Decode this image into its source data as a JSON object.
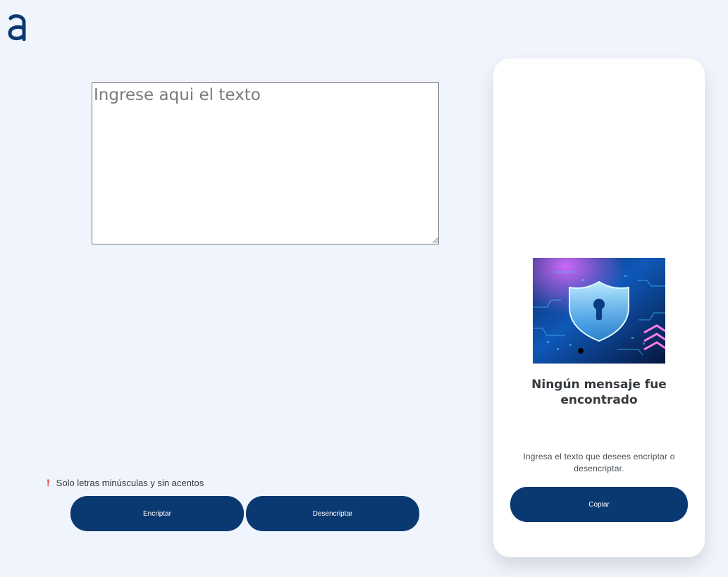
{
  "brand": {
    "logo_icon": "alura-a-logo-icon",
    "color": "#0A3871"
  },
  "input": {
    "placeholder": "Ingrese aqui el texto",
    "value": ""
  },
  "warning": {
    "icon": "exclamation-icon",
    "icon_glyph": "!",
    "text": "Solo letras minúsculas y sin acentos",
    "icon_color": "#E53935"
  },
  "actions": {
    "encrypt_label": "Encriptar",
    "decrypt_label": "Desencriptar"
  },
  "output": {
    "image_icon": "security-shield-lock-image",
    "title": "Ningún mensaje fue encontrado",
    "description": "Ingresa el texto que desees encriptar o desencriptar.",
    "copy_label": "Copiar"
  },
  "colors": {
    "background": "#F0F4FC",
    "button": "#0A3871",
    "panel": "#FFFFFF"
  }
}
